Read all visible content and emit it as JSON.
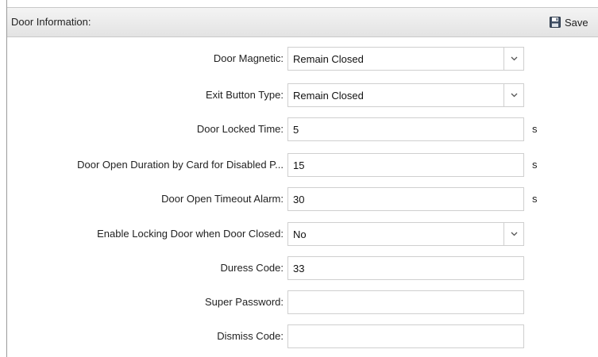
{
  "header": {
    "title": "Door Information:",
    "save_label": "Save"
  },
  "fields": [
    {
      "label": "Door Magnetic:",
      "value": "Remain Closed",
      "type": "select"
    },
    {
      "label": "Exit Button Type:",
      "value": "Remain Closed",
      "type": "select"
    },
    {
      "label": "Door Locked Time:",
      "value": "5",
      "type": "input",
      "unit": "s"
    },
    {
      "label": "Door Open Duration by Card for Disabled P...",
      "value": "15",
      "type": "input",
      "unit": "s"
    },
    {
      "label": "Door Open Timeout Alarm:",
      "value": "30",
      "type": "input",
      "unit": "s"
    },
    {
      "label": "Enable Locking Door when Door Closed:",
      "value": "No",
      "type": "select"
    },
    {
      "label": "Duress Code:",
      "value": "33",
      "type": "input"
    },
    {
      "label": "Super Password:",
      "value": "",
      "type": "input"
    },
    {
      "label": "Dismiss Code:",
      "value": "",
      "type": "input"
    }
  ],
  "icons": {
    "save": "floppy-disk-icon",
    "dropdown": "chevron-down-icon"
  }
}
